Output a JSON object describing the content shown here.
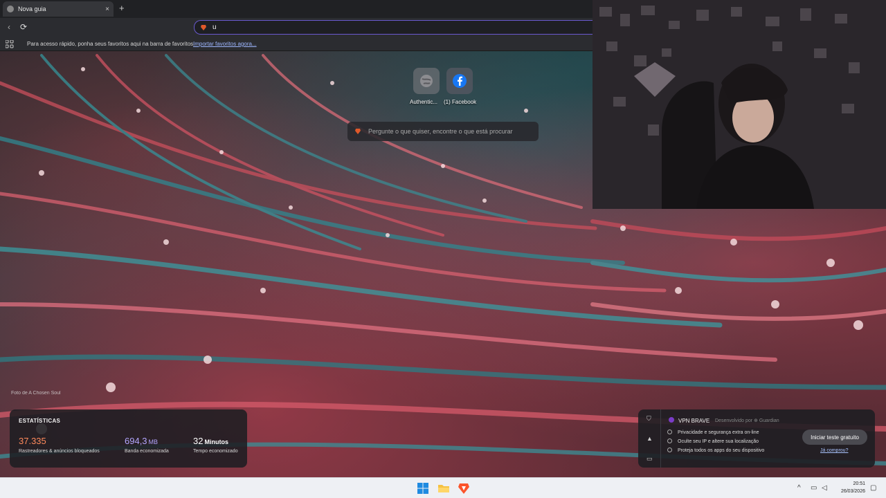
{
  "browser": {
    "tab_title": "Nova guia",
    "tab_close": "×",
    "new_tab": "+",
    "back": "‹",
    "reload": "⟳",
    "address_value": "u",
    "bookmarks_text": "Para acesso rápido, ponha seus favoritos aqui na barra de favoritos.",
    "bookmarks_link": "Importar favoritos agora..."
  },
  "top_sites": [
    {
      "label": "Authentic...",
      "icon": "globe-icon"
    },
    {
      "label": "(1) Facebook",
      "icon": "facebook-icon"
    }
  ],
  "search": {
    "placeholder": "Pergunte o que quiser, encontre o que está procurar"
  },
  "photo_credit": "Foto de A Chosen Soul",
  "stats": {
    "title": "ESTATÍSTICAS",
    "trackers_value": "37.335",
    "trackers_label": "Rastreadores & anúncios bloqueados",
    "bandwidth_value": "694,3",
    "bandwidth_unit": "MB",
    "bandwidth_label": "Banda economizada",
    "time_value": "32",
    "time_unit": "Minutos",
    "time_label": "Tempo economizado",
    "colors": {
      "trackers": "#ff8a5c",
      "bandwidth": "#b3a6ff",
      "time": "#ffffff"
    }
  },
  "vpn": {
    "title": "VPN BRAVE",
    "developer": "Desenvolvido por ⊕ Guardian",
    "features": [
      "Privacidade e segurança extra on-line",
      "Oculte seu IP e altere sua localização",
      "Proteja todos os apps do seu dispositivo"
    ],
    "cta": "Iniciar teste gratuito",
    "already": "Já comprou?"
  },
  "taskbar": {
    "time": "20:51",
    "date": "26/03/2026",
    "tray_chevron": "^"
  }
}
